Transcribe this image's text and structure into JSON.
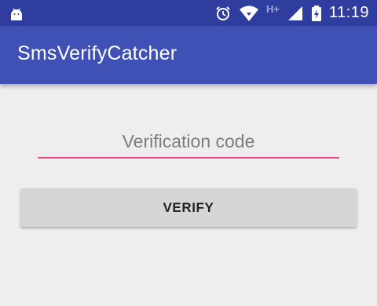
{
  "status_bar": {
    "icons": [
      "android-icon",
      "alarm-icon",
      "wifi-icon",
      "signal-icon",
      "battery-icon"
    ],
    "network_label": "H+",
    "time": "11:19",
    "color": "#2f3e9e"
  },
  "app_bar": {
    "title": "SmsVerifyCatcher",
    "color": "#3f51b5"
  },
  "form": {
    "code_input": {
      "value": "",
      "placeholder": "Verification code",
      "accent_color": "#e8437e"
    },
    "verify_button_label": "VERIFY"
  }
}
